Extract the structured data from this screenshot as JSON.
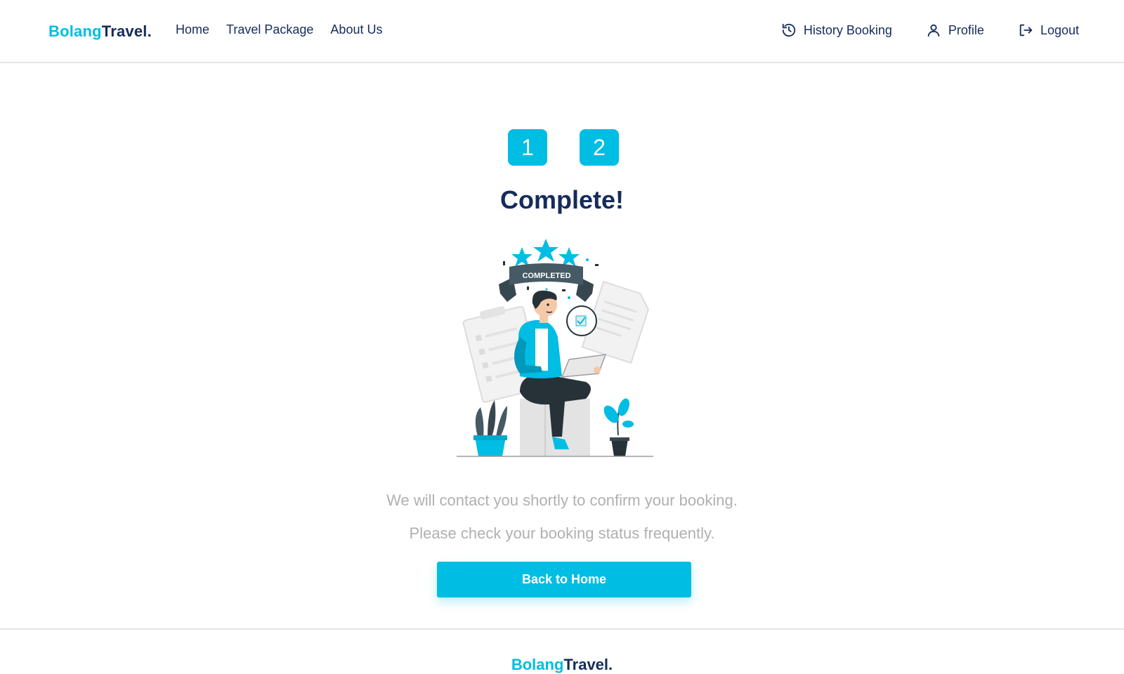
{
  "brand": {
    "part1": "Bolang",
    "part2": "Travel."
  },
  "nav": {
    "links": [
      "Home",
      "Travel Package",
      "About Us"
    ],
    "history_label": "History Booking",
    "profile_label": "Profile",
    "logout_label": "Logout"
  },
  "steps": [
    "1",
    "2"
  ],
  "title": "Complete!",
  "illustration": {
    "badge_text": "COMPLETED"
  },
  "messages": {
    "line1": "We will contact you shortly to confirm your booking.",
    "line2": "Please check your booking status frequently."
  },
  "button": {
    "label": "Back to Home"
  },
  "footer": {
    "brand_part1": "Bolang",
    "brand_part2": "Travel."
  },
  "colors": {
    "accent": "#00bde3",
    "primary": "#152c5b",
    "muted": "#b0b0b0"
  },
  "icons": {
    "history": "history-icon",
    "profile": "user-icon",
    "logout": "logout-icon"
  }
}
